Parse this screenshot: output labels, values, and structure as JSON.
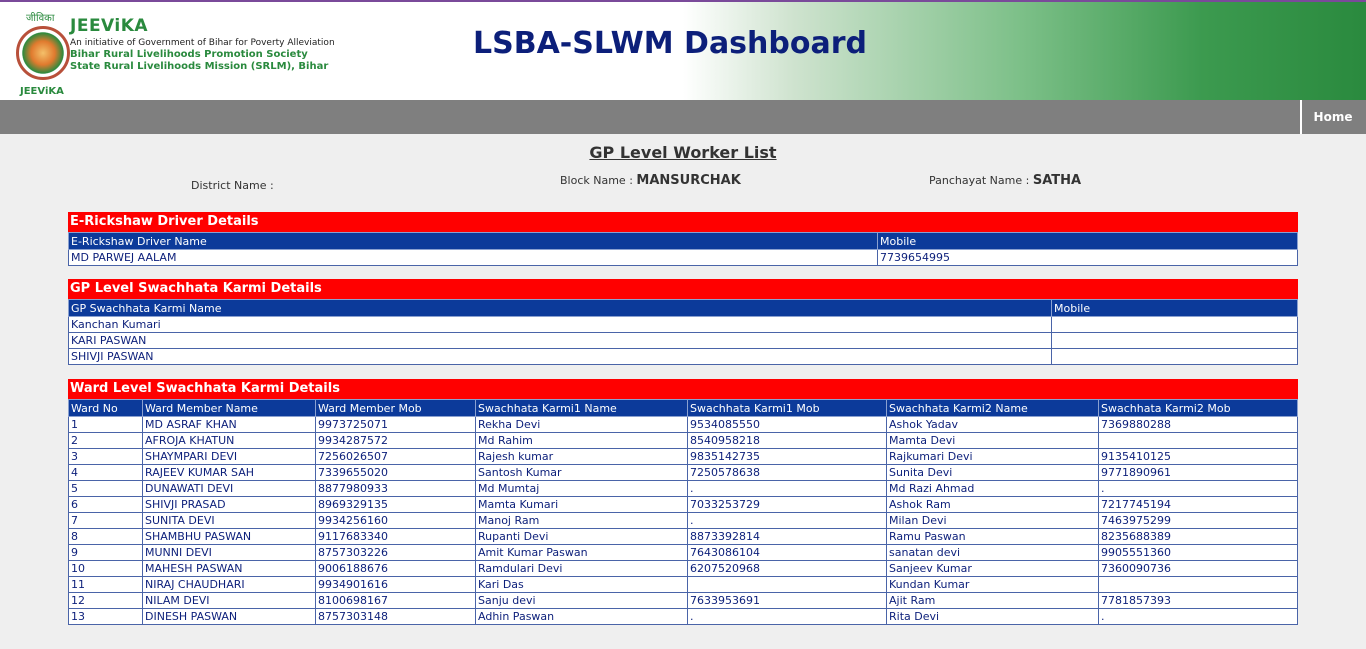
{
  "header": {
    "logo_top_text": "जीविका",
    "logo_bottom_text": "JEEViKA",
    "brand": "JEEViKA",
    "line1": "An initiative of Government of Bihar for Poverty Alleviation",
    "line2": "Bihar Rural Livelihoods Promotion Society",
    "line3": "State Rural Livelihoods Mission (SRLM), Bihar",
    "title": "LSBA-SLWM Dashboard"
  },
  "nav": {
    "home": "Home"
  },
  "page_title": "GP Level Worker List",
  "meta": {
    "district_label": "District Name :",
    "district_value": "",
    "block_label": "Block Name :",
    "block_value": "MANSURCHAK",
    "panchayat_label": "Panchayat Name :",
    "panchayat_value": "SATHA"
  },
  "erickshaw": {
    "title": "E-Rickshaw Driver Details",
    "headers": [
      "E-Rickshaw Driver Name",
      "Mobile"
    ],
    "rows": [
      [
        "MD PARWEJ AALAM",
        "7739654995"
      ]
    ]
  },
  "gp_karmi": {
    "title": "GP Level Swachhata Karmi Details",
    "headers": [
      "GP Swachhata Karmi Name",
      "Mobile"
    ],
    "rows": [
      [
        "Kanchan Kumari",
        ""
      ],
      [
        "KARI PASWAN",
        ""
      ],
      [
        "SHIVJI PASWAN",
        ""
      ]
    ]
  },
  "ward_karmi": {
    "title": "Ward Level Swachhata Karmi Details",
    "headers": [
      "Ward No",
      "Ward Member Name",
      "Ward Member Mob",
      "Swachhata Karmi1 Name",
      "Swachhata Karmi1 Mob",
      "Swachhata Karmi2 Name",
      "Swachhata Karmi2 Mob"
    ],
    "rows": [
      [
        "1",
        "MD ASRAF KHAN",
        "9973725071",
        "Rekha Devi",
        "9534085550",
        "Ashok Yadav",
        "7369880288"
      ],
      [
        "2",
        "AFROJA KHATUN",
        "9934287572",
        "Md Rahim",
        "8540958218",
        "Mamta Devi",
        ""
      ],
      [
        "3",
        "SHAYMPARI DEVI",
        "7256026507",
        "Rajesh kumar",
        "9835142735",
        "Rajkumari Devi",
        "9135410125"
      ],
      [
        "4",
        "RAJEEV KUMAR SAH",
        "7339655020",
        "Santosh Kumar",
        "7250578638",
        "Sunita Devi",
        "9771890961"
      ],
      [
        "5",
        "DUNAWATI DEVI",
        "8877980933",
        "Md Mumtaj",
        ".",
        "Md Razi Ahmad",
        "."
      ],
      [
        "6",
        "SHIVJI PRASAD",
        "8969329135",
        "Mamta Kumari",
        "7033253729",
        "Ashok Ram",
        "7217745194"
      ],
      [
        "7",
        "SUNITA DEVI",
        "9934256160",
        "Manoj Ram",
        ".",
        "Milan Devi",
        "7463975299"
      ],
      [
        "8",
        "SHAMBHU PASWAN",
        "9117683340",
        "Rupanti Devi",
        "8873392814",
        "Ramu Paswan",
        "8235688389"
      ],
      [
        "9",
        "MUNNI DEVI",
        "8757303226",
        "Amit Kumar Paswan",
        "7643086104",
        "sanatan devi",
        "9905551360"
      ],
      [
        "10",
        "MAHESH PASWAN",
        "9006188676",
        "Ramdulari Devi",
        "6207520968",
        "Sanjeev Kumar",
        "7360090736"
      ],
      [
        "11",
        "NIRAJ CHAUDHARI",
        "9934901616",
        "Kari Das",
        "",
        "Kundan Kumar",
        ""
      ],
      [
        "12",
        "NILAM DEVI",
        "8100698167",
        "Sanju devi",
        "7633953691",
        "Ajit Ram",
        "7781857393"
      ],
      [
        "13",
        "DINESH PASWAN",
        "8757303148",
        "Adhin Paswan",
        ".",
        "Rita Devi",
        "."
      ]
    ]
  }
}
